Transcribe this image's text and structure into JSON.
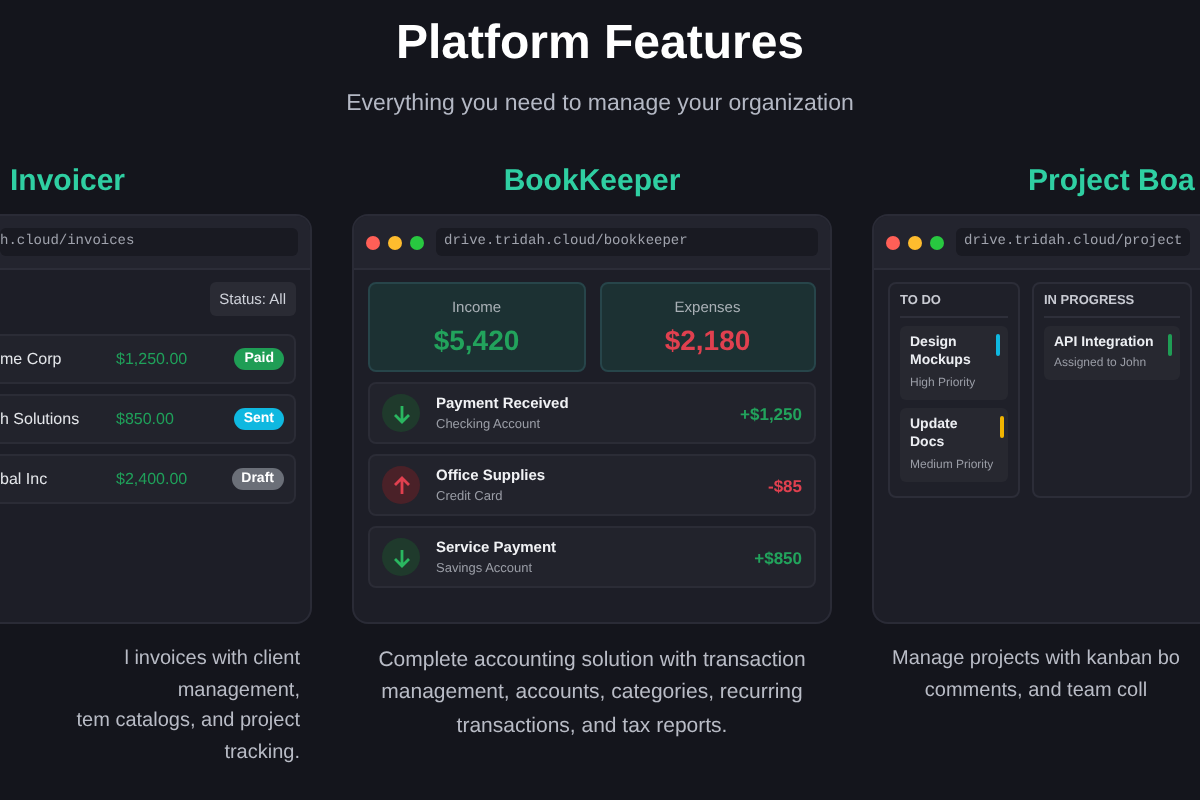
{
  "header": {
    "title": "Platform Features",
    "subtitle": "Everything you need to manage your organization"
  },
  "products": [
    {
      "kind": "invoices",
      "title": "Invoicer",
      "url": "h.cloud/invoices",
      "filter": "Status: All",
      "rows": [
        {
          "client": "me Corp",
          "amount": "$1,250.00",
          "status": "Paid",
          "color": "#1f9d55"
        },
        {
          "client": "h Solutions",
          "amount": "$850.00",
          "status": "Sent",
          "color": "#0fb8e0"
        },
        {
          "client": "bal Inc",
          "amount": "$2,400.00",
          "status": "Draft",
          "color": "#6b6f78"
        }
      ],
      "description": "l invoices with client management,\ntem catalogs, and project tracking."
    },
    {
      "kind": "ledger",
      "title": "BookKeeper",
      "url": "drive.tridah.cloud/bookkeeper",
      "summary": [
        {
          "label": "Income",
          "value": "$5,420",
          "kind": "in"
        },
        {
          "label": "Expenses",
          "value": "$2,180",
          "kind": "out"
        }
      ],
      "transactions": [
        {
          "kind": "in",
          "title": "Payment Received",
          "account": "Checking Account",
          "amount": "+$1,250"
        },
        {
          "kind": "out",
          "title": "Office Supplies",
          "account": "Credit Card",
          "amount": "-$85"
        },
        {
          "kind": "in",
          "title": "Service Payment",
          "account": "Savings Account",
          "amount": "+$850"
        }
      ],
      "description": "Complete accounting solution with transaction management, accounts, categories, recurring transactions, and tax reports."
    },
    {
      "kind": "board",
      "title": "Project Boa",
      "url": "drive.tridah.cloud/project",
      "columns": [
        {
          "title": "TO DO",
          "tasks": [
            {
              "title": "Design Mockups",
              "meta": "High Priority",
              "color": "#0fb8e0"
            },
            {
              "title": "Update Docs",
              "meta": "Medium Priority",
              "color": "#f0b400"
            }
          ]
        },
        {
          "title": "IN PROGRESS",
          "tasks": [
            {
              "title": "API Integration",
              "meta": "Assigned to John",
              "color": "#1f9d55"
            }
          ]
        }
      ],
      "description": "Manage projects with kanban bo\ncomments, and team coll"
    }
  ]
}
